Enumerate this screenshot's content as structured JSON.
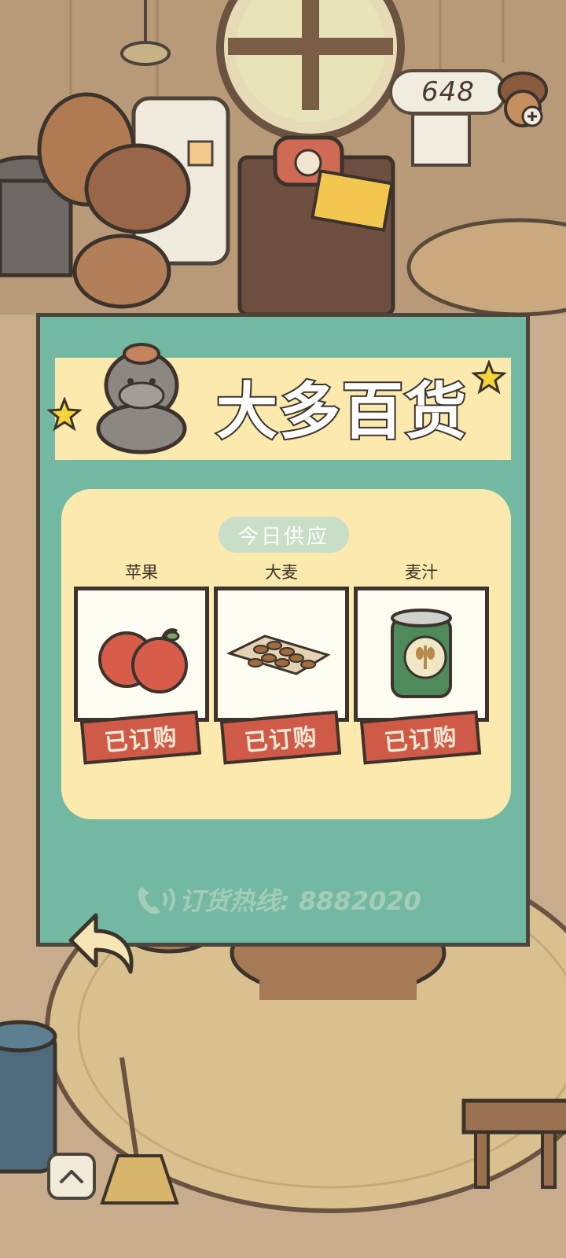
{
  "currency": {
    "value": "648",
    "icon": "acorn-icon"
  },
  "shop": {
    "title": "大多百货",
    "section_label": "今日供应",
    "items": [
      {
        "name": "苹果",
        "status": "已订购",
        "icon": "apple-icon"
      },
      {
        "name": "大麦",
        "status": "已订购",
        "icon": "barley-icon"
      },
      {
        "name": "麦汁",
        "status": "已订购",
        "icon": "wort-can-icon"
      }
    ],
    "hotline": "订货热线: 8882020"
  },
  "colors": {
    "panel": "#72b8a3",
    "banner": "#fbe9ad",
    "ordered_stamp": "#cf5a47",
    "outline": "#3b332c"
  }
}
